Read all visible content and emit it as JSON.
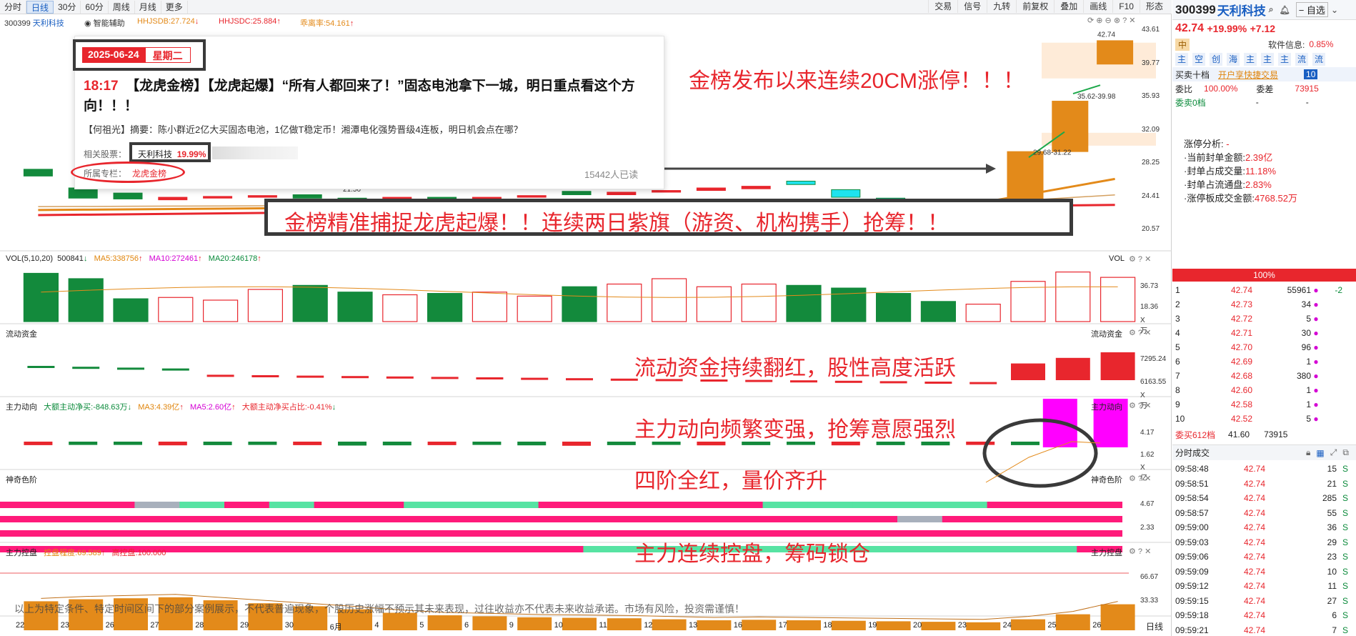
{
  "toolbar": {
    "periods": [
      "分时",
      "日线",
      "30分",
      "60分",
      "周线",
      "月线",
      "更多"
    ],
    "active_period": "日线",
    "right_items": [
      "交易",
      "信号",
      "九转",
      "前复权",
      "叠加",
      "画线",
      "F10",
      "形态"
    ]
  },
  "chart": {
    "stock_label": "300399 天利科技",
    "smart_assist": "智能辅助",
    "hhjsdb": "HHJSDB:27.724",
    "hhjsdc": "HHJSDC:25.884",
    "zhang_rate": "乖离率:54.161",
    "price_axis": [
      "43.61",
      "39.77",
      "35.93",
      "32.09",
      "28.25",
      "24.41",
      "20.57"
    ],
    "price_labels": {
      "high": "42.74",
      "band1": "35.62-39.98",
      "band2": "29.68-31.22",
      "low_tag": "21.50"
    },
    "vol": {
      "title": "VOL(5,10,20)",
      "value": "500841",
      "ma5": "MA5:338756",
      "ma10": "MA10:272461",
      "ma20": "MA20:246178",
      "axis": [
        "36.73",
        "18.36",
        "X万"
      ],
      "right_label": "VOL"
    },
    "flow": {
      "title": "流动资金",
      "axis": [
        "7295.24",
        "6163.55",
        "X万"
      ],
      "right_label": "流动资金"
    },
    "main_force": {
      "title": "主力动向",
      "net": "大额主动净买:-848.63万",
      "ma3": "MA3:4.39亿",
      "ma5": "MA5:2.60亿",
      "ratio": "大额主动净买占比:-0.41%",
      "axis": [
        "4.17",
        "1.62",
        "X亿"
      ],
      "right_label": "主力动向"
    },
    "magic": {
      "title": "神奇色阶",
      "axis": [
        "4.67",
        "2.33"
      ],
      "right_label": "神奇色阶"
    },
    "control": {
      "title": "主力控盘",
      "degree": "控盘程度:69.589",
      "high": "高控盘:100.000",
      "axis": [
        "66.67",
        "33.33"
      ],
      "right_label": "主力控盘"
    },
    "dates": [
      "22",
      "23",
      "26",
      "27",
      "28",
      "29",
      "30",
      "6月",
      "4",
      "5",
      "6",
      "9",
      "10",
      "11",
      "12",
      "13",
      "16",
      "17",
      "18",
      "19",
      "20",
      "23",
      "24",
      "25",
      "26"
    ],
    "date_mode": "日线",
    "disclaimer": "以上为特定条件、特定时间区间下的部分案例展示，不代表普遍现象，个股历史涨幅不预示其未来表现，过往收益亦不代表未来收益承诺。市场有风险，投资需谨慎！",
    "candles": [
      {
        "o": 27.6,
        "c": 26.8
      },
      {
        "o": 25.4,
        "c": 24.2
      },
      {
        "o": 24.8,
        "c": 24.1
      },
      {
        "o": 24.0,
        "c": 24.3
      },
      {
        "o": 24.2,
        "c": 24.4
      },
      {
        "o": 24.3,
        "c": 24.5
      },
      {
        "o": 24.6,
        "c": 24.2
      },
      {
        "o": 24.2,
        "c": 24.0
      },
      {
        "o": 24.0,
        "c": 24.3
      },
      {
        "o": 24.3,
        "c": 24.1
      },
      {
        "o": 24.1,
        "c": 24.3
      },
      {
        "o": 24.3,
        "c": 24.5
      },
      {
        "o": 25.0,
        "c": 24.6
      },
      {
        "o": 24.6,
        "c": 24.9
      },
      {
        "o": 24.9,
        "c": 25.1
      },
      {
        "o": 25.1,
        "c": 25.4
      },
      {
        "o": 25.3,
        "c": 25.6
      },
      {
        "o": 26.2,
        "c": 25.8
      },
      {
        "o": 25.2,
        "c": 24.3
      },
      {
        "o": 24.2,
        "c": 23.8
      },
      {
        "o": 23.6,
        "c": 23.2
      },
      {
        "o": 23.4,
        "c": 23.9
      },
      {
        "o": 24.0,
        "c": 29.68
      },
      {
        "o": 29.68,
        "c": 35.62
      },
      {
        "o": 39.98,
        "c": 42.74
      }
    ],
    "vol_values": [
      36,
      32,
      17,
      18,
      16,
      24,
      27,
      22,
      20,
      21,
      22,
      19,
      26,
      28,
      32,
      26,
      28,
      27,
      25,
      21,
      15,
      13,
      30,
      37,
      33
    ],
    "flow_values": [
      0.5,
      0.6,
      1.5,
      1.8,
      -1.0,
      -0.8,
      -1.1,
      -1.2,
      -1.3,
      -1.0,
      -1.1,
      -1.3,
      -1.5,
      -1.2,
      -1.1,
      -1.3,
      -1.2,
      -1.0,
      -1.0,
      -1.5,
      -1.6,
      -2.0,
      -3.0,
      -4.0,
      -5.0
    ],
    "mf_values": [
      0.3,
      0.2,
      0.2,
      0.4,
      0.3,
      0.2,
      0.3,
      0.5,
      0.4,
      0.3,
      0.2,
      0.4,
      0.6,
      0.3,
      0.2,
      0.4,
      0.3,
      0.2,
      0.4,
      0.3,
      0.4,
      0.2,
      0.3,
      4.2,
      4.3
    ],
    "control_values": [
      58,
      62,
      64,
      66,
      60,
      54,
      48,
      42,
      35,
      30,
      28,
      26,
      25,
      24,
      22,
      20,
      21,
      20,
      19,
      18,
      17,
      16,
      22,
      32,
      52
    ]
  },
  "card": {
    "date": "2025-06-24",
    "weekday": "星期二",
    "time": "18:17",
    "headline": "【龙虎金榜】【龙虎起爆】“所有人都回来了！”固态电池拿下一城，明日重点看这个方向！！！",
    "summary": "【何祖光】摘要：陈小群近2亿大买固态电池，1亿做T稳定币！湘潭电化强势晋级4连板，明日机会点在哪？",
    "related_label": "相关股票：",
    "related_stock": "天利科技",
    "related_pct": "19.99%",
    "column_label": "所属专栏：",
    "column_name": "龙虎金榜",
    "readers": "15442人已读"
  },
  "annotations": {
    "a1": "金榜发布以来连续20CM涨停！！！",
    "a2": "金榜精准捕捉龙虎起爆！！连续两日紫旗（游资、机构携手）抢筹！！",
    "a3": "流动资金持续翻红，股性高度活跃",
    "a4": "主力动向频繁变强，抢筹意愿强烈",
    "a5": "四阶全红，量价齐升",
    "a6": "主力连续控盘，筹码锁仓"
  },
  "side": {
    "code": "300399",
    "name": "天利科技",
    "self_select": "自选",
    "price": "42.74",
    "pct": "+19.99%",
    "chg": "+7.12",
    "tag": "中",
    "soft_info": "软件信息:",
    "soft_val": "0.85%",
    "icons": [
      "主",
      "空",
      "创",
      "海",
      "主",
      "主",
      "主",
      "流",
      "流"
    ],
    "book_title": "买卖十档",
    "open_book": "开户享快捷交易",
    "book_count": "10",
    "wei_bi": "委比",
    "wei_bi_val": "100.00%",
    "wei_cha": "委差",
    "wei_cha_val": "73915",
    "sell0": "委卖0档",
    "dash": "-",
    "analysis": {
      "title": "涨停分析:",
      "title_val": "-",
      "rows": [
        {
          "k": "·当前封单金额:",
          "v": "2.39亿"
        },
        {
          "k": "·封单占成交量:",
          "v": "11.18%"
        },
        {
          "k": "·封单占流通盘:",
          "v": "2.83%"
        },
        {
          "k": "·涨停板成交金额:",
          "v": "4768.52万"
        }
      ]
    },
    "percent": "100%",
    "bids": [
      {
        "n": "1",
        "p": "42.74",
        "v": "55961",
        "x": "-2"
      },
      {
        "n": "2",
        "p": "42.73",
        "v": "34"
      },
      {
        "n": "3",
        "p": "42.72",
        "v": "5"
      },
      {
        "n": "4",
        "p": "42.71",
        "v": "30"
      },
      {
        "n": "5",
        "p": "42.70",
        "v": "96"
      },
      {
        "n": "6",
        "p": "42.69",
        "v": "1"
      },
      {
        "n": "7",
        "p": "42.68",
        "v": "380"
      },
      {
        "n": "8",
        "p": "42.60",
        "v": "1"
      },
      {
        "n": "9",
        "p": "42.58",
        "v": "1"
      },
      {
        "n": "10",
        "p": "42.52",
        "v": "5"
      }
    ],
    "buy_summary": "委买612档",
    "buy_price": "41.60",
    "buy_vol": "73915",
    "trade_title": "分时成交",
    "trades": [
      {
        "t": "09:58:48",
        "p": "42.74",
        "v": "15"
      },
      {
        "t": "09:58:51",
        "p": "42.74",
        "v": "21"
      },
      {
        "t": "09:58:54",
        "p": "42.74",
        "v": "285"
      },
      {
        "t": "09:58:57",
        "p": "42.74",
        "v": "55"
      },
      {
        "t": "09:59:00",
        "p": "42.74",
        "v": "36"
      },
      {
        "t": "09:59:03",
        "p": "42.74",
        "v": "29"
      },
      {
        "t": "09:59:06",
        "p": "42.74",
        "v": "23"
      },
      {
        "t": "09:59:09",
        "p": "42.74",
        "v": "10"
      },
      {
        "t": "09:59:12",
        "p": "42.74",
        "v": "11"
      },
      {
        "t": "09:59:15",
        "p": "42.74",
        "v": "27"
      },
      {
        "t": "09:59:18",
        "p": "42.74",
        "v": "6"
      },
      {
        "t": "09:59:21",
        "p": "42.74",
        "v": "7"
      }
    ],
    "trade_flag": "S"
  },
  "colors": {
    "up": "#e8262d",
    "down": "#138a3c",
    "magenta": "#ff00ff",
    "pink": "#ff1a7a",
    "cyan": "#1ee3ee",
    "mint": "#57e3a3",
    "orange": "#e38a1a",
    "accent": "#1a5fc2"
  }
}
